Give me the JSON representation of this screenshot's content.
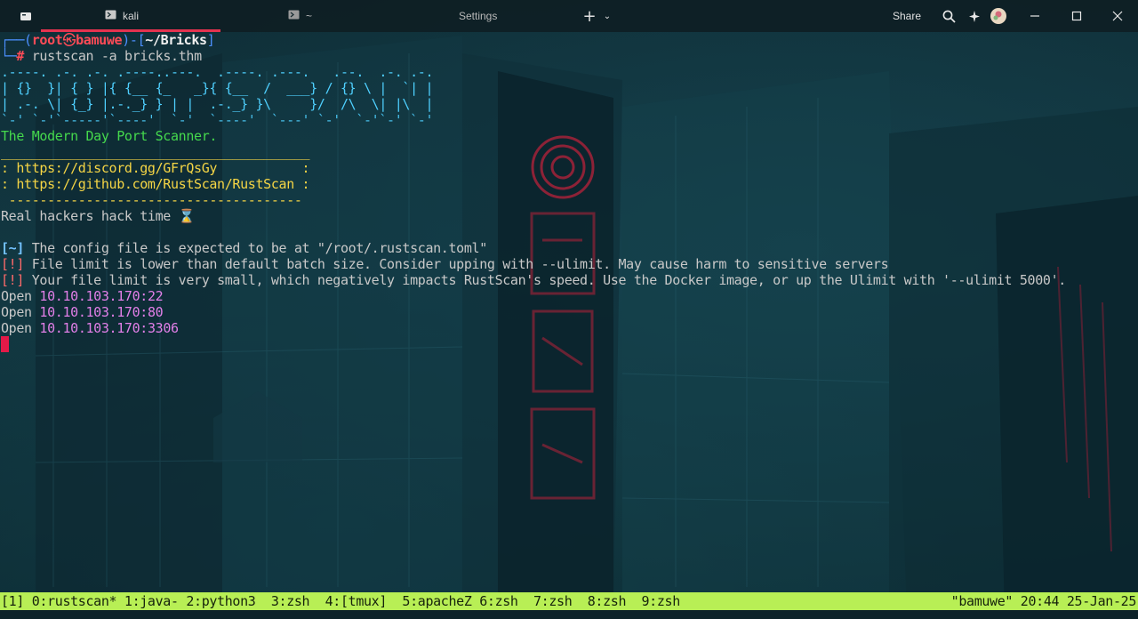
{
  "titlebar": {
    "tabs": [
      {
        "label": "kali",
        "icon": "terminal-icon"
      },
      {
        "label": "~",
        "icon": "terminal-icon"
      }
    ],
    "title": "Settings",
    "share_label": "Share",
    "icons": [
      "app-icon",
      "plus-icon",
      "chevron-down-icon",
      "search-icon",
      "sparkle-icon",
      "avatar",
      "minimize-icon",
      "maximize-icon",
      "close-icon"
    ]
  },
  "terminal": {
    "prompt": {
      "user": "root",
      "at_symbol": "㉿",
      "host": "bamuwe",
      "dir": "~/Bricks",
      "hash": "#",
      "command": "rustscan",
      "flag": "-a",
      "arg": "bricks.thm"
    },
    "banner": [
      ".----. .-. .-. .----..---.  .----. .---.   .--.  .-. .-.",
      "| {}  }| { } |{ {__ {_   _}{ {__  /  ___} / {} \\ |  `| |",
      "| .-. \\| {_} |.-._} } | |  .-._} }\\     }/  /\\  \\| |\\  |",
      "`-' `-'`-----'`----'  `-'  `----'  `---' `-'  `-'`-' `-'"
    ],
    "tagline": "The Modern Day Port Scanner.",
    "rule_top": "________________________________________",
    "discord": ": https://discord.gg/GFrQsGy           :",
    "github": ": https://github.com/RustScan/RustScan :",
    "rule_bottom": " --------------------------------------",
    "motto": "Real hackers hack time ⌛",
    "messages": [
      {
        "tag": "[~]",
        "text": " The config file is expected to be at \"/root/.rustscan.toml\""
      },
      {
        "tag": "[!]",
        "text": " File limit is lower than default batch size. Consider upping with --ulimit. May cause harm to sensitive servers"
      },
      {
        "tag": "[!]",
        "text": " Your file limit is very small, which negatively impacts RustScan's speed. Use the Docker image, or up the Ulimit with '--ulimit 5000'."
      }
    ],
    "open_ports": [
      {
        "label": "Open",
        "addr": "10.10.103.170:22"
      },
      {
        "label": "Open",
        "addr": "10.10.103.170:80"
      },
      {
        "label": "Open",
        "addr": "10.10.103.170:3306"
      }
    ]
  },
  "tmux": {
    "windows": "[1] 0:rustscan* 1:java- 2:python3  3:zsh  4:[tmux]  5:apacheZ 6:zsh  7:zsh  8:zsh  9:zsh",
    "status_right": "\"bamuwe\" 20:44 25-Jan-25"
  },
  "colors": {
    "accent": "#e4334f",
    "tmux_bar": "#b8ef55",
    "prompt_blue": "#4c8fff",
    "prompt_red": "#ff4b57"
  }
}
